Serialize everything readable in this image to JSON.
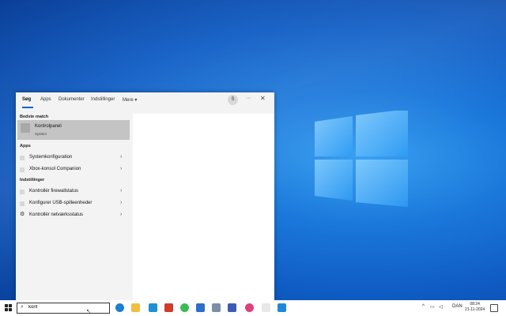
{
  "search_tabs": {
    "items": [
      {
        "label": "Søg"
      },
      {
        "label": "Apps"
      },
      {
        "label": "Dokumenter"
      },
      {
        "label": "Indstillinger"
      },
      {
        "label": "Mere ▾"
      }
    ],
    "avatar_initial": "S",
    "more_options": "···",
    "close": "✕"
  },
  "best_match": {
    "section": "Bedste match",
    "title": "Kontrolpanel",
    "subtitle": "System"
  },
  "apps": {
    "section": "Apps",
    "items": [
      {
        "label": "Systemkonfiguration"
      },
      {
        "label": "Xbox-konsol Companion"
      }
    ]
  },
  "settings": {
    "section": "Indstillinger",
    "items": [
      {
        "label": "Kontrollér firewallstatus"
      },
      {
        "label": "Konfigurer USB-spilleenheder"
      },
      {
        "label": "Kontrollér netværksstatus"
      }
    ]
  },
  "chevron": "›",
  "taskbar": {
    "search_value": "konf",
    "language": "DAN",
    "time": "08:24",
    "date": "21-11-2024"
  },
  "colors": {
    "accent": "#0067c0",
    "best_match_bg": "#c4c4c4"
  }
}
